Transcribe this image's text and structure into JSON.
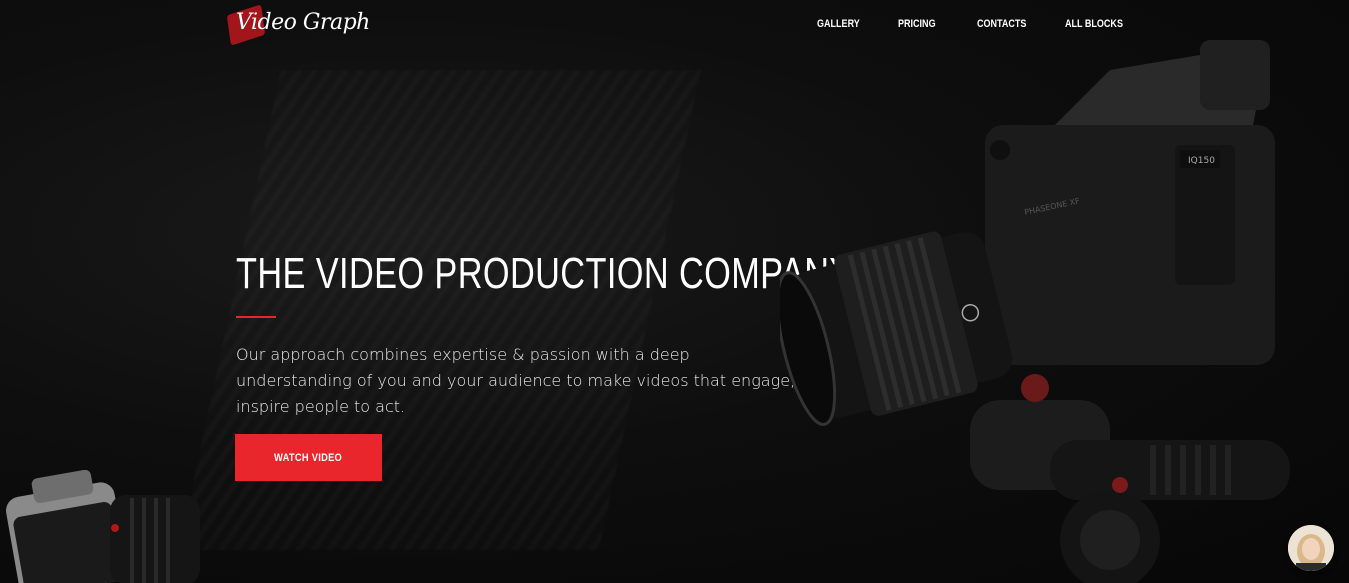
{
  "brand": {
    "logo_text": "Video Graph"
  },
  "nav": {
    "items": [
      {
        "label": "GALLERY"
      },
      {
        "label": "PRICING"
      },
      {
        "label": "CONTACTS"
      },
      {
        "label": "ALL BLOCKS"
      }
    ]
  },
  "hero": {
    "title": "THE VIDEO PRODUCTION COMPANY",
    "description": "Our approach combines expertise & passion with a deep understanding of you and your audience to make videos that engage, inspire people to act.",
    "cta_label": "WATCH VIDEO"
  },
  "camera": {
    "model_label": "IQ150",
    "brand_label": "PHASEONE XF"
  },
  "colors": {
    "accent": "#e8262b",
    "background": "#0b0b0b",
    "text": "#ffffff"
  },
  "icons": {
    "avatar": "user-avatar",
    "logo": "brush-logo-icon"
  }
}
